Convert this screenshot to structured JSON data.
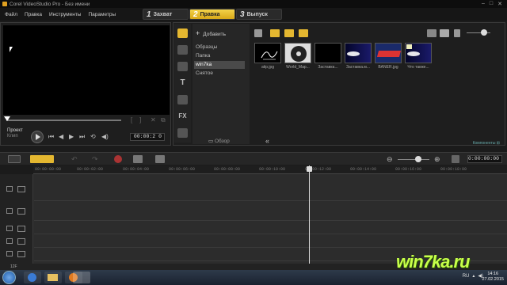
{
  "window": {
    "title": "Corel VideoStudio Pro - Без имени",
    "controls": [
      "–",
      "□",
      "✕"
    ]
  },
  "menu": [
    "Файл",
    "Правка",
    "Инструменты",
    "Параметры"
  ],
  "steps": [
    {
      "num": "1",
      "label": "Захват",
      "active": false
    },
    {
      "num": "2",
      "label": "Правка",
      "active": true
    },
    {
      "num": "3",
      "label": "Выпуск",
      "active": false
    }
  ],
  "preview": {
    "project_label": "Проект",
    "clip_label": "Клип",
    "timecode": "00:00:2 0"
  },
  "library": {
    "add_label": "Добавить",
    "folders": [
      {
        "label": "Образцы",
        "selected": false
      },
      {
        "label": "Папка",
        "selected": false
      },
      {
        "label": "win7ka",
        "selected": true
      },
      {
        "label": "Снятое",
        "selected": false
      }
    ],
    "browse_label": "Обзор",
    "options_label": "Компоненты ⊞",
    "thumbnails": [
      {
        "caption": "atip.jpg",
        "icon": "signature-thumb"
      },
      {
        "caption": "World_Map...",
        "icon": "disc-thumb"
      },
      {
        "caption": "Заставка...",
        "icon": "black-thumb"
      },
      {
        "caption": "Заставка.м...",
        "icon": "comet-thumb"
      },
      {
        "caption": "BANER.jpg",
        "icon": "banner-thumb"
      },
      {
        "caption": "Что также...",
        "icon": "comet-thumb"
      }
    ]
  },
  "timeline": {
    "timecode": "0:00:00:00",
    "ruler": [
      "00:00:00:00",
      "00:00:02:00",
      "00:00:04:00",
      "00:00:06:00",
      "00:00:08:00",
      "00:00:10:00",
      "00:00:12:00",
      "00:00:14:00",
      "00:00:16:00",
      "00:00:18:00"
    ],
    "zoom_label": "12F"
  },
  "taskbar": {
    "lang": "RU",
    "time": "14:16",
    "date": "27.02.2015"
  },
  "watermark": "win7ka.ru"
}
